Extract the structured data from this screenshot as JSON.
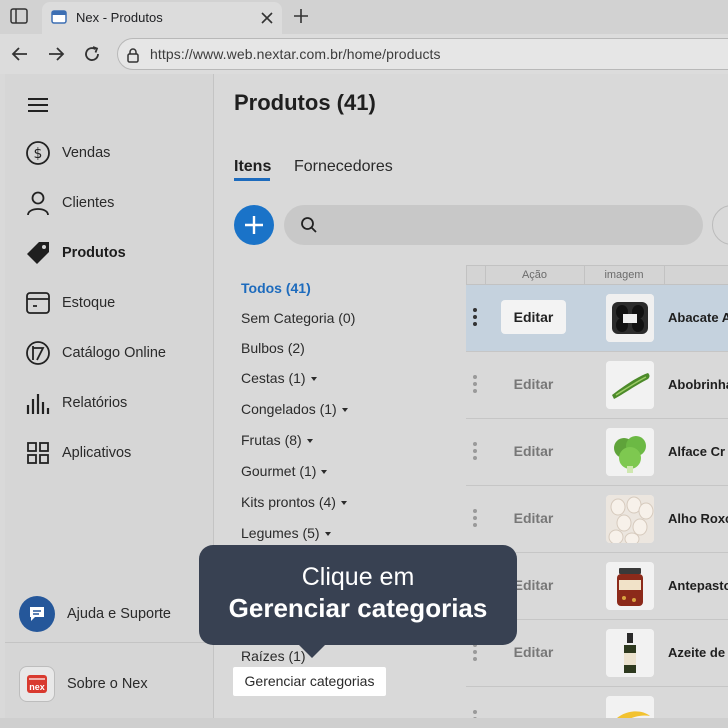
{
  "browser": {
    "tab_title": "Nex - Produtos",
    "url": "https://www.web.nextar.com.br/home/products"
  },
  "sidebar": {
    "items": [
      {
        "label": "Vendas",
        "icon": "dollar-icon"
      },
      {
        "label": "Clientes",
        "icon": "user-icon"
      },
      {
        "label": "Produtos",
        "icon": "tag-icon",
        "active": true
      },
      {
        "label": "Estoque",
        "icon": "box-icon"
      },
      {
        "label": "Catálogo Online",
        "icon": "catalog-icon"
      },
      {
        "label": "Relatórios",
        "icon": "bars-icon"
      },
      {
        "label": "Aplicativos",
        "icon": "grid-icon"
      }
    ],
    "help_label": "Ajuda e Suporte",
    "about_label": "Sobre o Nex",
    "logo_text": "nex"
  },
  "main": {
    "title": "Produtos (41)",
    "tabs": [
      "Itens",
      "Fornecedores"
    ],
    "categories": [
      {
        "label": "Todos (41)",
        "active": true
      },
      {
        "label": "Sem Categoria (0)"
      },
      {
        "label": "Bulbos (2)"
      },
      {
        "label": "Cestas (1)",
        "dropdown": true
      },
      {
        "label": "Congelados (1)",
        "dropdown": true
      },
      {
        "label": "Frutas (8)",
        "dropdown": true
      },
      {
        "label": "Gourmet (1)",
        "dropdown": true
      },
      {
        "label": "Kits prontos (4)",
        "dropdown": true
      },
      {
        "label": "Legumes (5)",
        "dropdown": true
      },
      {
        "label": "Raízes (1)"
      }
    ],
    "table": {
      "headers": [
        "Ação",
        "imagem"
      ],
      "edit_label": "Editar",
      "rows": [
        {
          "name": "Abacate A",
          "selected": true
        },
        {
          "name": "Abobrinha"
        },
        {
          "name": "Alface Cr"
        },
        {
          "name": "Alho Roxo"
        },
        {
          "name": "Antepasto"
        },
        {
          "name": "Azeite de"
        }
      ]
    },
    "manage_categories": "Gerenciar categorias"
  },
  "tooltip": {
    "line1": "Clique em",
    "line2": "Gerenciar categorias"
  },
  "colors": {
    "accent": "#1a73c8",
    "tooltip_bg": "#384152",
    "selected_row": "#c5d2de"
  }
}
